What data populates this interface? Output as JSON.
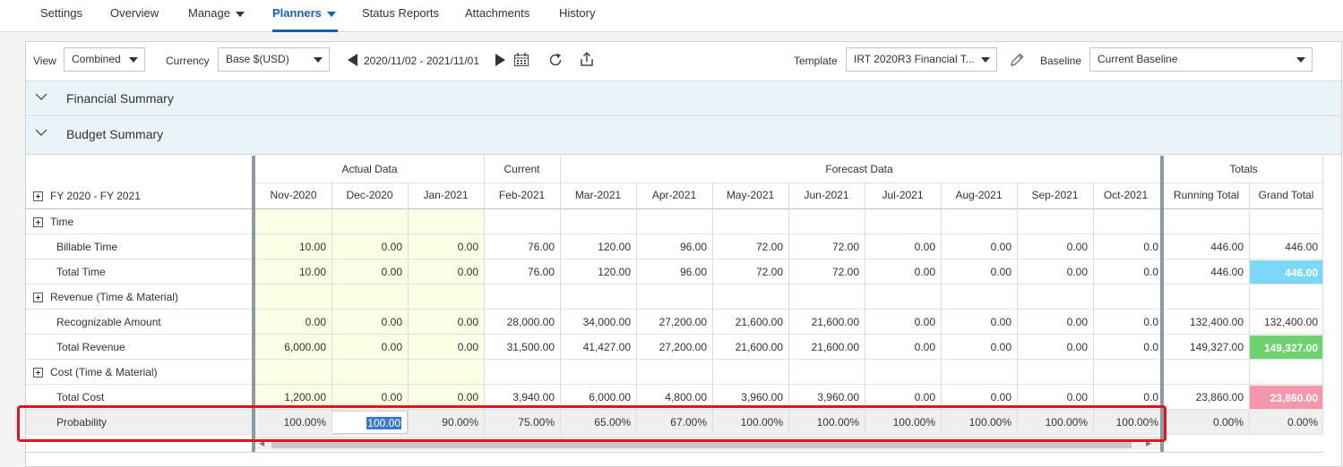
{
  "nav": {
    "tabs": [
      {
        "label": "Settings"
      },
      {
        "label": "Overview"
      },
      {
        "label": "Manage"
      },
      {
        "label": "Planners"
      },
      {
        "label": "Status Reports"
      },
      {
        "label": "Attachments"
      },
      {
        "label": "History"
      }
    ]
  },
  "toolbar": {
    "view_label": "View",
    "view_value": "Combined",
    "currency_label": "Currency",
    "currency_value": "Base $(USD)",
    "date_range": "2020/11/02 - 2021/11/01",
    "template_label": "Template",
    "template_value": "IRT 2020R3 Financial T...",
    "baseline_label": "Baseline",
    "baseline_value": "Current Baseline"
  },
  "sections": {
    "financial_summary": "Financial Summary",
    "budget_summary": "Budget Summary"
  },
  "grid": {
    "period_label": "FY 2020 - FY 2021",
    "groups": {
      "actual": "Actual Data",
      "current": "Current",
      "forecast": "Forecast Data",
      "totals": "Totals"
    },
    "months": [
      "Nov-2020",
      "Dec-2020",
      "Jan-2021",
      "Feb-2021",
      "Mar-2021",
      "Apr-2021",
      "May-2021",
      "Jun-2021",
      "Jul-2021",
      "Aug-2021",
      "Sep-2021",
      "Oct-2021"
    ],
    "total_headers": [
      "Running Total",
      "Grand Total"
    ],
    "rows": [
      {
        "label": "Time",
        "group": true,
        "values": [],
        "totals": []
      },
      {
        "label": "Billable Time",
        "values": [
          "10.00",
          "0.00",
          "0.00",
          "76.00",
          "120.00",
          "96.00",
          "72.00",
          "72.00",
          "0.00",
          "0.00",
          "0.00",
          "0.0"
        ],
        "totals": [
          "446.00",
          "446.00"
        ]
      },
      {
        "label": "Total Time",
        "values": [
          "10.00",
          "0.00",
          "0.00",
          "76.00",
          "120.00",
          "96.00",
          "72.00",
          "72.00",
          "0.00",
          "0.00",
          "0.00",
          "0.0"
        ],
        "totals": [
          "446.00",
          "446.00"
        ],
        "grand_color": "#7dd8f8"
      },
      {
        "label": "Revenue (Time & Material)",
        "group": true,
        "values": [],
        "totals": []
      },
      {
        "label": "Recognizable Amount",
        "values": [
          "0.00",
          "0.00",
          "0.00",
          "28,000.00",
          "34,000.00",
          "27,200.00",
          "21,600.00",
          "21,600.00",
          "0.00",
          "0.00",
          "0.00",
          "0.0"
        ],
        "totals": [
          "132,400.00",
          "132,400.00"
        ]
      },
      {
        "label": "Total Revenue",
        "values": [
          "6,000.00",
          "0.00",
          "0.00",
          "31,500.00",
          "41,427.00",
          "27,200.00",
          "21,600.00",
          "21,600.00",
          "0.00",
          "0.00",
          "0.00",
          "0.0"
        ],
        "totals": [
          "149,327.00",
          "149,327.00"
        ],
        "grand_color": "#6fd16f"
      },
      {
        "label": "Cost (Time & Material)",
        "group": true,
        "values": [],
        "totals": []
      },
      {
        "label": "Total Cost",
        "values": [
          "1,200.00",
          "0.00",
          "0.00",
          "3,940.00",
          "6,000.00",
          "4,800.00",
          "3,960.00",
          "3,960.00",
          "0.00",
          "0.00",
          "0.00",
          "0.0"
        ],
        "totals": [
          "23,860.00",
          "23,860.00"
        ],
        "grand_color": "#f597ab"
      },
      {
        "label": "Probability",
        "values": [
          "100.00%",
          "100.00",
          "90.00%",
          "75.00%",
          "65.00%",
          "67.00%",
          "100.00%",
          "100.00%",
          "100.00%",
          "100.00%",
          "100.00%",
          "100.00%"
        ],
        "totals": [
          "0.00%",
          "0.00%"
        ],
        "highlight": true
      }
    ]
  },
  "colors": {
    "accent": "#1a5fa8",
    "actual_bg": "#fdfde6",
    "highlight_box": "#e0141c",
    "section_bg": "#eaf3f8"
  }
}
